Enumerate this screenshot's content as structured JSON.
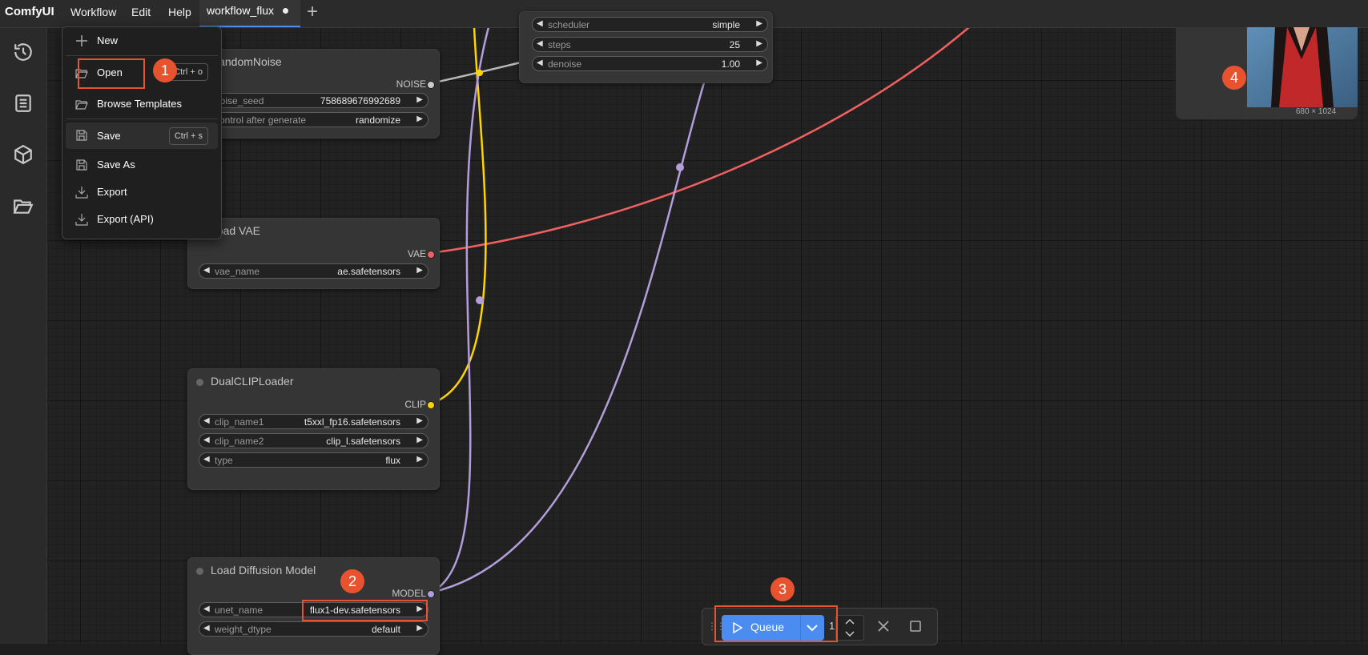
{
  "app": {
    "name": "ComfyUI"
  },
  "menubar": {
    "items": [
      "Workflow",
      "Edit",
      "Help"
    ]
  },
  "tab": {
    "label": "workflow_flux",
    "new_tab": "+"
  },
  "sidebar": {
    "icons": [
      "history-icon",
      "queue-list-icon",
      "model-library-icon",
      "workflows-folder-icon"
    ]
  },
  "dropdown": {
    "new": "New",
    "open": "Open",
    "open_shortcut": "Ctrl + o",
    "browse_templates": "Browse Templates",
    "save": "Save",
    "save_shortcut": "Ctrl + s",
    "save_as": "Save As",
    "export": "Export",
    "export_api": "Export (API)"
  },
  "nodes": {
    "scheduler": {
      "scheduler": {
        "label": "scheduler",
        "value": "simple"
      },
      "steps": {
        "label": "steps",
        "value": "25"
      },
      "denoise": {
        "label": "denoise",
        "value": "1.00"
      }
    },
    "random_noise": {
      "title": "RandomNoise",
      "output": "NOISE",
      "noise_seed": {
        "label": "noise_seed",
        "value": "758689676992689"
      },
      "control": {
        "label": "control after generate",
        "value": "randomize"
      }
    },
    "load_vae": {
      "title": "Load VAE",
      "output": "VAE",
      "vae_name": {
        "label": "vae_name",
        "value": "ae.safetensors"
      }
    },
    "dual_clip": {
      "title": "DualCLIPLoader",
      "output": "CLIP",
      "clip_name1": {
        "label": "clip_name1",
        "value": "t5xxl_fp16.safetensors"
      },
      "clip_name2": {
        "label": "clip_name2",
        "value": "clip_l.safetensors"
      },
      "type": {
        "label": "type",
        "value": "flux"
      }
    },
    "load_diffusion": {
      "title": "Load Diffusion Model",
      "output": "MODEL",
      "unet_name": {
        "label": "unet_name",
        "value": "flux1-dev.safetensors"
      },
      "weight_dtype": {
        "label": "weight_dtype",
        "value": "default"
      }
    }
  },
  "preview": {
    "size": "680 × 1024"
  },
  "queue": {
    "label": "Queue",
    "count": "1"
  },
  "annotations": {
    "one": "1",
    "two": "2",
    "three": "3",
    "four": "4"
  },
  "colors": {
    "accent": "#4a8cf0",
    "annotation": "#e8532f",
    "vae_link": "#f06060",
    "clip_link": "#ffd500",
    "model_link": "#b39ddb",
    "noise_link": "#cccccc"
  }
}
